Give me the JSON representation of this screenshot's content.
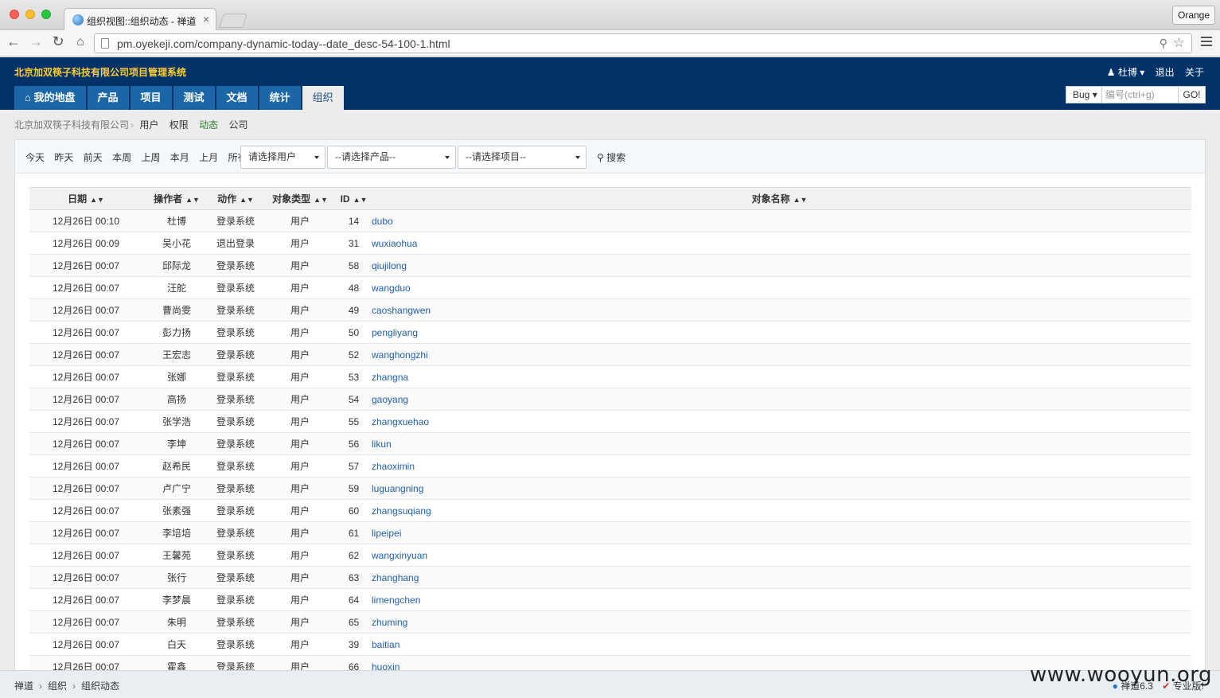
{
  "browser": {
    "tab_title": "组织视图::组织动态 - 禅道",
    "tab_close": "×",
    "profile_button": "Orange",
    "url": "pm.oyekeji.com/company-dynamic-today--date_desc-54-100-1.html"
  },
  "header": {
    "company": "北京加双筷子科技有限公司项目管理系统",
    "user": "杜博",
    "logout": "退出",
    "about": "关于"
  },
  "main_nav": [
    {
      "label": "我的地盘"
    },
    {
      "label": "产品"
    },
    {
      "label": "项目"
    },
    {
      "label": "测试"
    },
    {
      "label": "文档"
    },
    {
      "label": "统计"
    },
    {
      "label": "组织"
    }
  ],
  "quick_search": {
    "type": "Bug",
    "placeholder": "编号(ctrl+g)",
    "go": "GO!"
  },
  "subnav": {
    "company": "北京加双筷子科技有限公司",
    "links": [
      "用户",
      "权限",
      "动态",
      "公司"
    ]
  },
  "filters": {
    "dates": [
      "今天",
      "昨天",
      "前天",
      "本周",
      "上周",
      "本月",
      "上月",
      "所有"
    ],
    "user_select": "请选择用户",
    "product_select": "--请选择产品--",
    "project_select": "--请选择项目--",
    "search": "搜索"
  },
  "table": {
    "headers": [
      "日期",
      "操作者",
      "动作",
      "对象类型",
      "ID",
      "对象名称"
    ],
    "rows": [
      [
        "12月26日 00:10",
        "杜博",
        "登录系统",
        "用户",
        "14",
        "dubo"
      ],
      [
        "12月26日 00:09",
        "吴小花",
        "退出登录",
        "用户",
        "31",
        "wuxiaohua"
      ],
      [
        "12月26日 00:07",
        "邱际龙",
        "登录系统",
        "用户",
        "58",
        "qiujilong"
      ],
      [
        "12月26日 00:07",
        "汪舵",
        "登录系统",
        "用户",
        "48",
        "wangduo"
      ],
      [
        "12月26日 00:07",
        "曹尚雯",
        "登录系统",
        "用户",
        "49",
        "caoshangwen"
      ],
      [
        "12月26日 00:07",
        "彭力扬",
        "登录系统",
        "用户",
        "50",
        "pengliyang"
      ],
      [
        "12月26日 00:07",
        "王宏志",
        "登录系统",
        "用户",
        "52",
        "wanghongzhi"
      ],
      [
        "12月26日 00:07",
        "张娜",
        "登录系统",
        "用户",
        "53",
        "zhangna"
      ],
      [
        "12月26日 00:07",
        "高扬",
        "登录系统",
        "用户",
        "54",
        "gaoyang"
      ],
      [
        "12月26日 00:07",
        "张学浩",
        "登录系统",
        "用户",
        "55",
        "zhangxuehao"
      ],
      [
        "12月26日 00:07",
        "李坤",
        "登录系统",
        "用户",
        "56",
        "likun"
      ],
      [
        "12月26日 00:07",
        "赵希民",
        "登录系统",
        "用户",
        "57",
        "zhaoximin"
      ],
      [
        "12月26日 00:07",
        "卢广宁",
        "登录系统",
        "用户",
        "59",
        "luguangning"
      ],
      [
        "12月26日 00:07",
        "张素强",
        "登录系统",
        "用户",
        "60",
        "zhangsuqiang"
      ],
      [
        "12月26日 00:07",
        "李培培",
        "登录系统",
        "用户",
        "61",
        "lipeipei"
      ],
      [
        "12月26日 00:07",
        "王馨苑",
        "登录系统",
        "用户",
        "62",
        "wangxinyuan"
      ],
      [
        "12月26日 00:07",
        "张行",
        "登录系统",
        "用户",
        "63",
        "zhanghang"
      ],
      [
        "12月26日 00:07",
        "李梦晨",
        "登录系统",
        "用户",
        "64",
        "limengchen"
      ],
      [
        "12月26日 00:07",
        "朱明",
        "登录系统",
        "用户",
        "65",
        "zhuming"
      ],
      [
        "12月26日 00:07",
        "白天",
        "登录系统",
        "用户",
        "39",
        "baitian"
      ],
      [
        "12月26日 00:07",
        "霍鑫",
        "登录系统",
        "用户",
        "66",
        "huoxin"
      ]
    ]
  },
  "footer": {
    "crumbs": [
      "禅道",
      "组织",
      "组织动态"
    ],
    "version": "禅道6.3",
    "edition": "专业版!"
  },
  "watermark": "www.wooyun.org",
  "colors": {
    "header_bg": "#033269",
    "nav_bg": "#1a66a7",
    "company_title": "#ffcc33",
    "link": "#1f5fa8"
  }
}
